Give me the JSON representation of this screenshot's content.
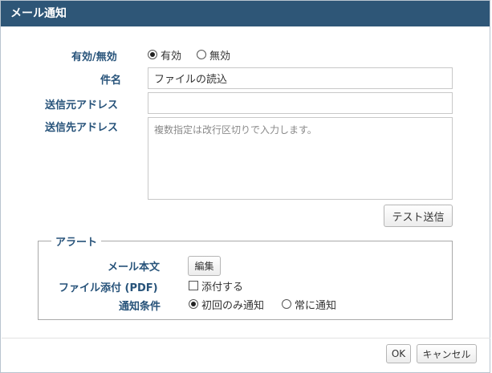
{
  "dialog": {
    "title": "メール通知"
  },
  "form": {
    "enabled": {
      "label": "有効/無効",
      "options": [
        "有効",
        "無効"
      ],
      "selected": "有効"
    },
    "subject": {
      "label": "件名",
      "value": "ファイルの読込"
    },
    "from_address": {
      "label": "送信元アドレス",
      "value": ""
    },
    "to_address": {
      "label": "送信先アドレス",
      "value": "",
      "placeholder": "複数指定は改行区切りで入力します。"
    },
    "test_send_label": "テスト送信"
  },
  "alert": {
    "legend": "アラート",
    "body": {
      "label": "メール本文",
      "edit_label": "編集"
    },
    "attach": {
      "label": "ファイル添付 (PDF)",
      "checkbox_label": "添付する",
      "checked": false
    },
    "condition": {
      "label": "通知条件",
      "options": [
        "初回のみ通知",
        "常に通知"
      ],
      "selected": "初回のみ通知"
    }
  },
  "footer": {
    "ok_label": "OK",
    "cancel_label": "キャンセル"
  }
}
